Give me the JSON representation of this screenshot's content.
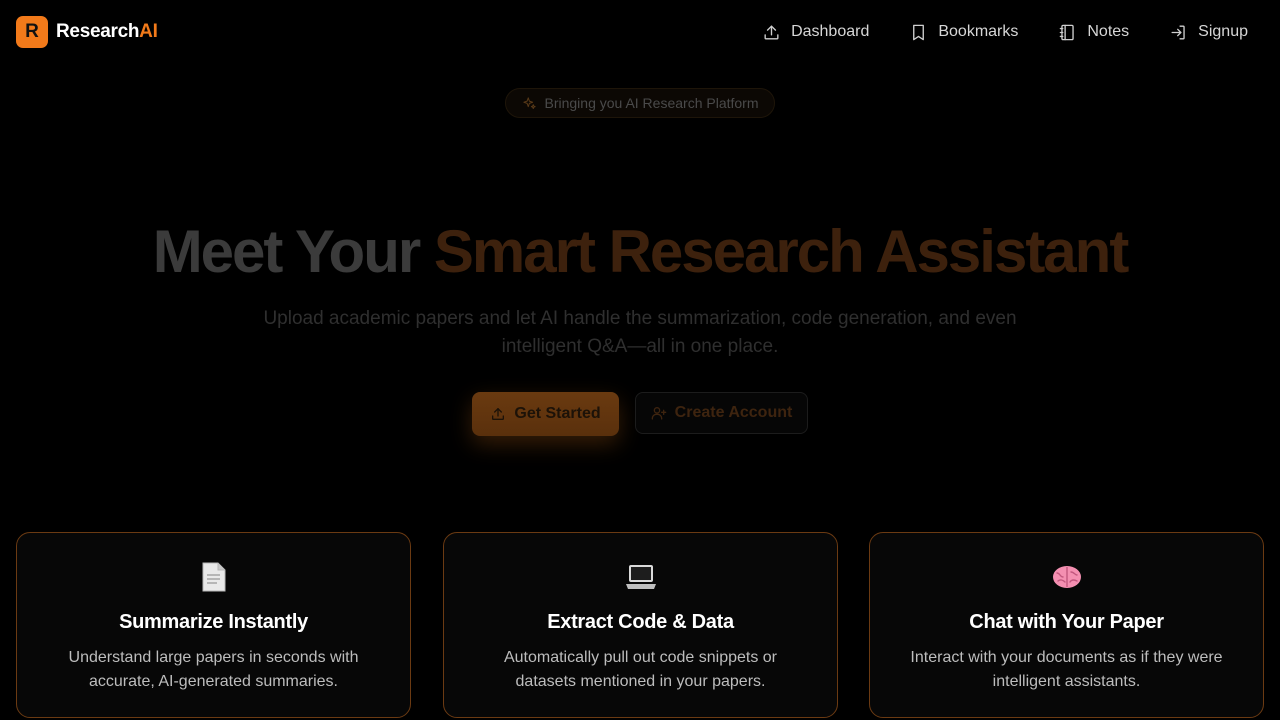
{
  "brand": {
    "mark": "R",
    "name_main": "Research",
    "name_accent": "AI"
  },
  "nav": [
    {
      "label": "Dashboard",
      "icon": "upload-icon"
    },
    {
      "label": "Bookmarks",
      "icon": "bookmark-icon"
    },
    {
      "label": "Notes",
      "icon": "notebook-icon"
    },
    {
      "label": "Signup",
      "icon": "login-icon"
    }
  ],
  "hero": {
    "badge": "Bringing you AI Research Platform",
    "title_main": "Meet Your ",
    "title_accent": "Smart Research Assistant",
    "subtitle": "Upload academic papers and let AI handle the summarization, code generation, and even intelligent Q&A—all in one place.",
    "primary_button": "Get Started",
    "secondary_button": "Create Account"
  },
  "features": [
    {
      "emoji": "📄",
      "icon": "document-icon",
      "title": "Summarize Instantly",
      "desc": "Understand large papers in seconds with accurate, AI-generated summaries."
    },
    {
      "emoji": "💻",
      "icon": "laptop-icon",
      "title": "Extract Code & Data",
      "desc": "Automatically pull out code snippets or datasets mentioned in your papers."
    },
    {
      "emoji": "🧠",
      "icon": "brain-icon",
      "title": "Chat with Your Paper",
      "desc": "Interact with your documents as if they were intelligent assistants."
    }
  ],
  "colors": {
    "accent": "#f27a1a",
    "background": "#000000",
    "card_border": "#6b3a12"
  }
}
